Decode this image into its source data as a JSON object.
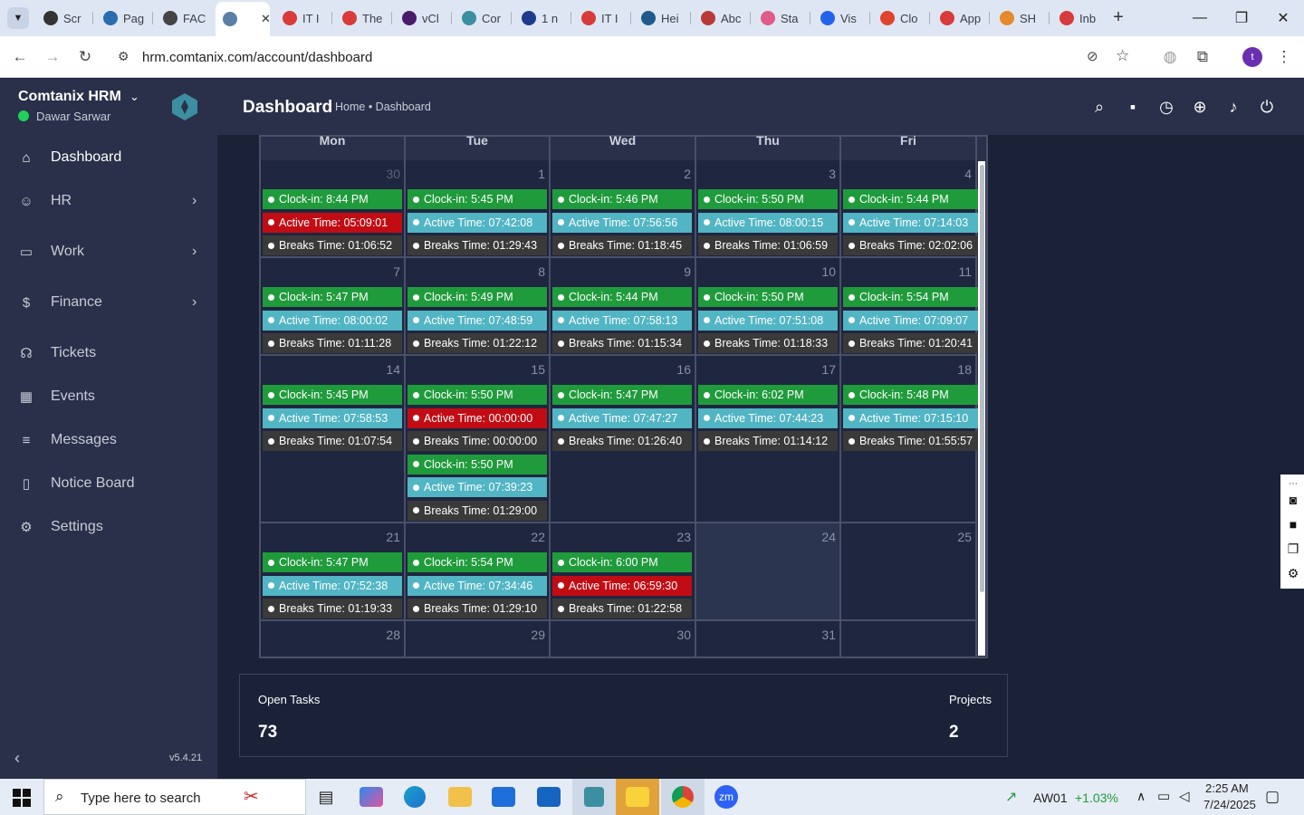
{
  "browser": {
    "tabs": [
      {
        "label": "Scr",
        "color": "#333333"
      },
      {
        "label": "Pag",
        "color": "#2b6cb0"
      },
      {
        "label": "FAC",
        "color": "#444444"
      },
      {
        "label": "",
        "color": "#5b7fa6"
      },
      {
        "label": "IT I",
        "color": "#d93a3a"
      },
      {
        "label": "The",
        "color": "#d93a3a"
      },
      {
        "label": "vCl",
        "color": "#4a1b6b"
      },
      {
        "label": "Cor",
        "color": "#3b8fa0"
      },
      {
        "label": "1 n",
        "color": "#1e3a8a"
      },
      {
        "label": "IT I",
        "color": "#d93a3a"
      },
      {
        "label": "Hei",
        "color": "#1e5a8a"
      },
      {
        "label": "Abc",
        "color": "#b83a3a"
      },
      {
        "label": "Sta",
        "color": "#e05a8a"
      },
      {
        "label": "Vis",
        "color": "#2563eb"
      },
      {
        "label": "Clo",
        "color": "#e0442f"
      },
      {
        "label": "App",
        "color": "#d93a3a"
      },
      {
        "label": "SH",
        "color": "#e58a2a"
      },
      {
        "label": "Inb",
        "color": "#d93a3a"
      }
    ],
    "url": "hrm.comtanix.com/account/dashboard",
    "profile_initial": "t"
  },
  "sidebar": {
    "app_name": "Comtanix HRM",
    "user_name": "Dawar Sarwar",
    "version": "v5.4.21",
    "items": [
      {
        "label": "Dashboard",
        "icon": "home-icon"
      },
      {
        "label": "HR",
        "icon": "users-icon"
      },
      {
        "label": "Work",
        "icon": "briefcase-icon"
      },
      {
        "label": "Finance",
        "icon": "dollar-icon"
      },
      {
        "label": "Tickets",
        "icon": "headset-icon"
      },
      {
        "label": "Events",
        "icon": "calendar-icon"
      },
      {
        "label": "Messages",
        "icon": "message-icon"
      },
      {
        "label": "Notice Board",
        "icon": "clipboard-icon"
      },
      {
        "label": "Settings",
        "icon": "gear-icon"
      }
    ]
  },
  "header": {
    "title": "Dashboard",
    "breadcrumb": "Home • Dashboard"
  },
  "calendar": {
    "days": [
      "Mon",
      "Tue",
      "Wed",
      "Thu",
      "Fri"
    ],
    "weeks": [
      [
        {
          "num": "30",
          "muted": true,
          "events": [
            [
              "green",
              "Clock-in: 8:44 PM"
            ],
            [
              "red",
              "Active Time: 05:09:01"
            ],
            [
              "dark",
              "Breaks Time: 01:06:52"
            ]
          ]
        },
        {
          "num": "1",
          "events": [
            [
              "green",
              "Clock-in: 5:45 PM"
            ],
            [
              "blue",
              "Active Time: 07:42:08"
            ],
            [
              "dark",
              "Breaks Time: 01:29:43"
            ]
          ]
        },
        {
          "num": "2",
          "events": [
            [
              "green",
              "Clock-in: 5:46 PM"
            ],
            [
              "blue",
              "Active Time: 07:56:56"
            ],
            [
              "dark",
              "Breaks Time: 01:18:45"
            ]
          ]
        },
        {
          "num": "3",
          "events": [
            [
              "green",
              "Clock-in: 5:50 PM"
            ],
            [
              "blue",
              "Active Time: 08:00:15"
            ],
            [
              "dark",
              "Breaks Time: 01:06:59"
            ]
          ]
        },
        {
          "num": "4",
          "events": [
            [
              "green",
              "Clock-in: 5:44 PM"
            ],
            [
              "blue",
              "Active Time: 07:14:03"
            ],
            [
              "dark",
              "Breaks Time: 02:02:06"
            ]
          ]
        }
      ],
      [
        {
          "num": "7",
          "events": [
            [
              "green",
              "Clock-in: 5:47 PM"
            ],
            [
              "blue",
              "Active Time: 08:00:02"
            ],
            [
              "dark",
              "Breaks Time: 01:11:28"
            ]
          ]
        },
        {
          "num": "8",
          "events": [
            [
              "green",
              "Clock-in: 5:49 PM"
            ],
            [
              "blue",
              "Active Time: 07:48:59"
            ],
            [
              "dark",
              "Breaks Time: 01:22:12"
            ]
          ]
        },
        {
          "num": "9",
          "events": [
            [
              "green",
              "Clock-in: 5:44 PM"
            ],
            [
              "blue",
              "Active Time: 07:58:13"
            ],
            [
              "dark",
              "Breaks Time: 01:15:34"
            ]
          ]
        },
        {
          "num": "10",
          "events": [
            [
              "green",
              "Clock-in: 5:50 PM"
            ],
            [
              "blue",
              "Active Time: 07:51:08"
            ],
            [
              "dark",
              "Breaks Time: 01:18:33"
            ]
          ]
        },
        {
          "num": "11",
          "events": [
            [
              "green",
              "Clock-in: 5:54 PM"
            ],
            [
              "blue",
              "Active Time: 07:09:07"
            ],
            [
              "dark",
              "Breaks Time: 01:20:41"
            ]
          ]
        }
      ],
      [
        {
          "num": "14",
          "events": [
            [
              "green",
              "Clock-in: 5:45 PM"
            ],
            [
              "blue",
              "Active Time: 07:58:53"
            ],
            [
              "dark",
              "Breaks Time: 01:07:54"
            ]
          ]
        },
        {
          "num": "15",
          "events": [
            [
              "green",
              "Clock-in: 5:50 PM"
            ],
            [
              "red",
              "Active Time: 00:00:00"
            ],
            [
              "dark",
              "Breaks Time: 00:00:00"
            ],
            [
              "green",
              "Clock-in: 5:50 PM"
            ],
            [
              "blue",
              "Active Time: 07:39:23"
            ],
            [
              "dark",
              "Breaks Time: 01:29:00"
            ]
          ]
        },
        {
          "num": "16",
          "events": [
            [
              "green",
              "Clock-in: 5:47 PM"
            ],
            [
              "blue",
              "Active Time: 07:47:27"
            ],
            [
              "dark",
              "Breaks Time: 01:26:40"
            ]
          ]
        },
        {
          "num": "17",
          "events": [
            [
              "green",
              "Clock-in: 6:02 PM"
            ],
            [
              "blue",
              "Active Time: 07:44:23"
            ],
            [
              "dark",
              "Breaks Time: 01:14:12"
            ]
          ]
        },
        {
          "num": "18",
          "events": [
            [
              "green",
              "Clock-in: 5:48 PM"
            ],
            [
              "blue",
              "Active Time: 07:15:10"
            ],
            [
              "dark",
              "Breaks Time: 01:55:57"
            ]
          ]
        }
      ],
      [
        {
          "num": "21",
          "events": [
            [
              "green",
              "Clock-in: 5:47 PM"
            ],
            [
              "blue",
              "Active Time: 07:52:38"
            ],
            [
              "dark",
              "Breaks Time: 01:19:33"
            ]
          ]
        },
        {
          "num": "22",
          "events": [
            [
              "green",
              "Clock-in: 5:54 PM"
            ],
            [
              "blue",
              "Active Time: 07:34:46"
            ],
            [
              "dark",
              "Breaks Time: 01:29:10"
            ]
          ]
        },
        {
          "num": "23",
          "events": [
            [
              "green",
              "Clock-in: 6:00 PM"
            ],
            [
              "red",
              "Active Time: 06:59:30"
            ],
            [
              "dark",
              "Breaks Time: 01:22:58"
            ]
          ]
        },
        {
          "num": "24",
          "today": true,
          "events": []
        },
        {
          "num": "25",
          "events": []
        }
      ],
      [
        {
          "num": "28",
          "events": []
        },
        {
          "num": "29",
          "events": []
        },
        {
          "num": "30",
          "events": []
        },
        {
          "num": "31",
          "events": []
        },
        {
          "num": "",
          "events": []
        }
      ]
    ]
  },
  "stats": {
    "open_tasks_label": "Open Tasks",
    "open_tasks_value": "73",
    "projects_label": "Projects",
    "projects_value": "2"
  },
  "taskbar": {
    "search_placeholder": "Type here to search",
    "stock_name": "AW01",
    "stock_change": "+1.03%",
    "time": "2:25 AM",
    "date": "7/24/2025"
  },
  "colors": {
    "sidebar_bg": "#2a3049",
    "main_bg": "#1b2238",
    "clockin_green": "#1f9b3c",
    "active_blue": "#51b5c4",
    "alert_red": "#c20c14",
    "break_dark": "#3a3a3a",
    "status_online": "#1fd15a",
    "logo_accent": "#3b8fa0"
  }
}
